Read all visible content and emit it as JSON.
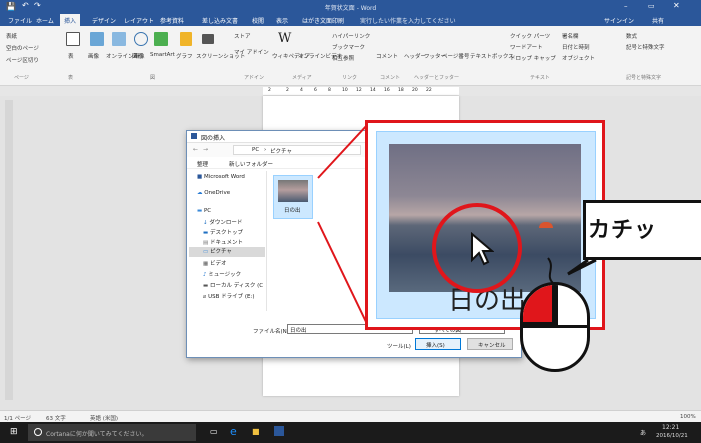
{
  "window": {
    "title": "年賀状文面 - Word",
    "signin": "サインイン",
    "share": "共有",
    "accent": "#2b579a"
  },
  "menu": {
    "tabs": [
      "ファイル",
      "ホーム",
      "挿入",
      "デザイン",
      "レイアウト",
      "参考資料",
      "差し込み文書",
      "校閲",
      "表示",
      "はがき文面印刷"
    ],
    "active_tab": "挿入",
    "tellme": "実行したい作業を入力してください"
  },
  "ribbon": {
    "pages": [
      "表紙",
      "空白のページ",
      "ページ区切り"
    ],
    "groups": [
      "ページ",
      "表",
      "図",
      "アドイン",
      "メディア",
      "リンク",
      "コメント",
      "ヘッダーとフッター",
      "テキスト",
      "記号と特殊文字"
    ],
    "table": "表",
    "images": [
      "画像",
      "オンライン画像",
      "図形",
      "SmartArt",
      "グラフ",
      "スクリーンショット"
    ],
    "addin": [
      "ストア",
      "マイ アドイン"
    ],
    "media": [
      "ウィキペディア",
      "オンラインビデオ"
    ],
    "links": [
      "ハイパーリンク",
      "ブックマーク",
      "相互参照"
    ],
    "comment": "コメント",
    "headerfooter": [
      "ヘッダー",
      "フッター",
      "ページ番号"
    ],
    "text": [
      "テキストボックス",
      "クイック パーツ",
      "ワードアート",
      "ドロップ キャップ",
      "署名欄",
      "日付と時刻",
      "オブジェクト"
    ],
    "symbols": [
      "数式",
      "記号と特殊文字"
    ]
  },
  "ruler": {
    "marks": [
      "2",
      "2",
      "4",
      "6",
      "8",
      "10",
      "12",
      "14",
      "16",
      "18",
      "20",
      "22"
    ]
  },
  "dialog": {
    "title": "図の挿入",
    "breadcrumb": [
      "PC",
      "ピクチャ"
    ],
    "organize": "整理",
    "new_folder": "新しいフォルダー",
    "sidebar": [
      {
        "label": "Microsoft Word",
        "icon": "word-icon"
      },
      {
        "label": "OneDrive",
        "icon": "cloud-icon"
      },
      {
        "label": "PC",
        "icon": "pc-icon"
      },
      {
        "label": "ダウンロード",
        "icon": "download-icon"
      },
      {
        "label": "デスクトップ",
        "icon": "desktop-icon"
      },
      {
        "label": "ドキュメント",
        "icon": "document-icon"
      },
      {
        "label": "ピクチャ",
        "icon": "picture-icon"
      },
      {
        "label": "ビデオ",
        "icon": "video-icon"
      },
      {
        "label": "ミュージック",
        "icon": "music-icon"
      },
      {
        "label": "ローカル ディスク (C",
        "icon": "disk-icon"
      },
      {
        "label": "USB ドライブ (E:)",
        "icon": "usb-icon"
      }
    ],
    "file_name": "日の出",
    "filename_label": "ファイル名(N):",
    "filter": "すべての図",
    "tools": "ツール(L)",
    "insert": "挿入(S)",
    "cancel": "キャンセル"
  },
  "zoom": {
    "caption": "日の出"
  },
  "callout": {
    "text": "カチッ"
  },
  "status": {
    "page": "1/1 ページ",
    "words": "63 文字",
    "lang": "英語 (米国)",
    "zoom": "100%"
  },
  "taskbar": {
    "cortana": "Cortanaに何か聞いてみてください。",
    "time": "12:21",
    "date": "2016/10/21",
    "ime": "あ"
  }
}
